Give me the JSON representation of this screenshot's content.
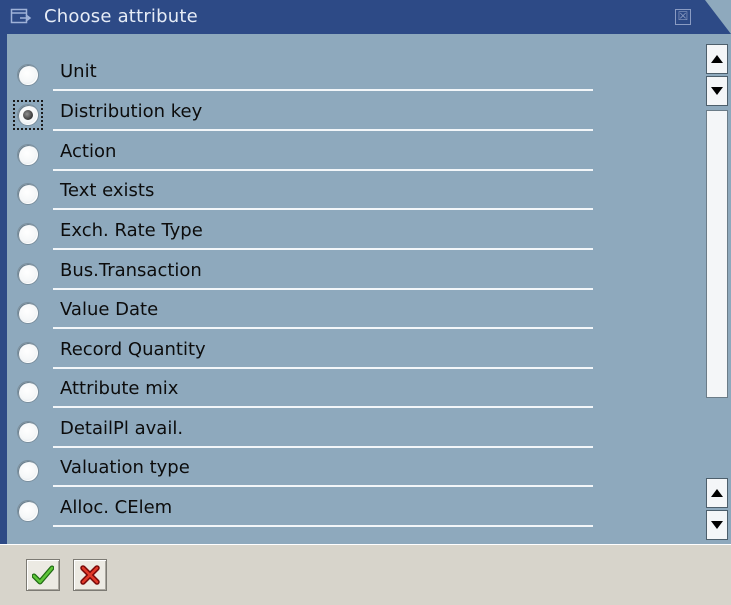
{
  "window": {
    "title": "Choose attribute",
    "close_symbol": "☒"
  },
  "options": [
    {
      "label": "Unit",
      "selected": false
    },
    {
      "label": "Distribution key",
      "selected": true
    },
    {
      "label": "Action",
      "selected": false
    },
    {
      "label": "Text exists",
      "selected": false
    },
    {
      "label": "Exch. Rate Type",
      "selected": false
    },
    {
      "label": "Bus.Transaction",
      "selected": false
    },
    {
      "label": "Value Date",
      "selected": false
    },
    {
      "label": "Record Quantity",
      "selected": false
    },
    {
      "label": "Attribute mix",
      "selected": false
    },
    {
      "label": "DetailPl avail.",
      "selected": false
    },
    {
      "label": "Valuation type",
      "selected": false
    },
    {
      "label": "Alloc. CElem",
      "selected": false
    }
  ],
  "footer": {
    "confirm_icon": "green-checkmark-icon",
    "cancel_icon": "red-x-icon"
  },
  "colors": {
    "title_bar": "#2d4a86",
    "panel": "#8ea9bd",
    "footer": "#d7d4cb"
  }
}
